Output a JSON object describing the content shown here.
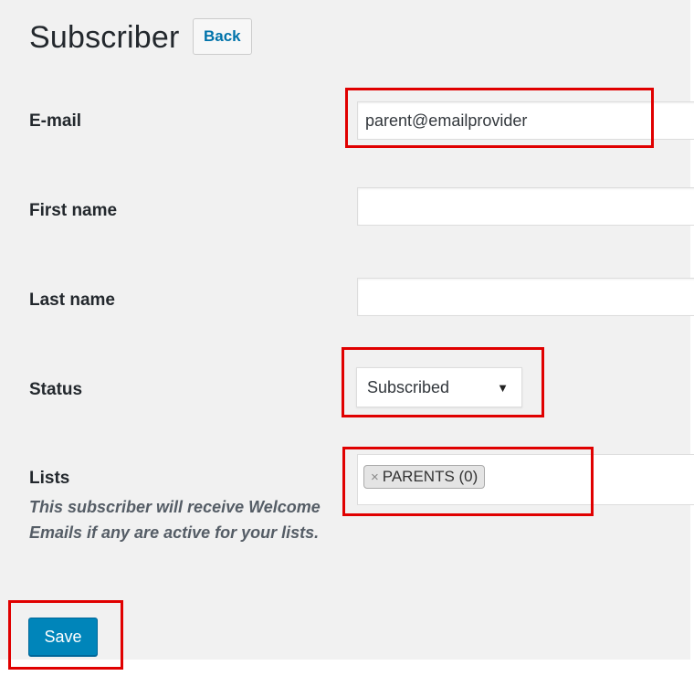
{
  "header": {
    "title": "Subscriber",
    "back_label": "Back"
  },
  "form": {
    "email": {
      "label": "E-mail",
      "value": "parent@emailprovider"
    },
    "first_name": {
      "label": "First name",
      "value": ""
    },
    "last_name": {
      "label": "Last name",
      "value": ""
    },
    "status": {
      "label": "Status",
      "value": "Subscribed"
    },
    "lists": {
      "label": "Lists",
      "description": "This subscriber will receive Welcome Emails if any are active for your lists.",
      "selected": [
        {
          "remove_symbol": "×",
          "label": "PARENTS (0)"
        }
      ]
    },
    "save_label": "Save"
  },
  "colors": {
    "background": "#f1f1f1",
    "primary_button": "#0085ba",
    "link": "#0073aa",
    "highlight": "#e00000"
  }
}
